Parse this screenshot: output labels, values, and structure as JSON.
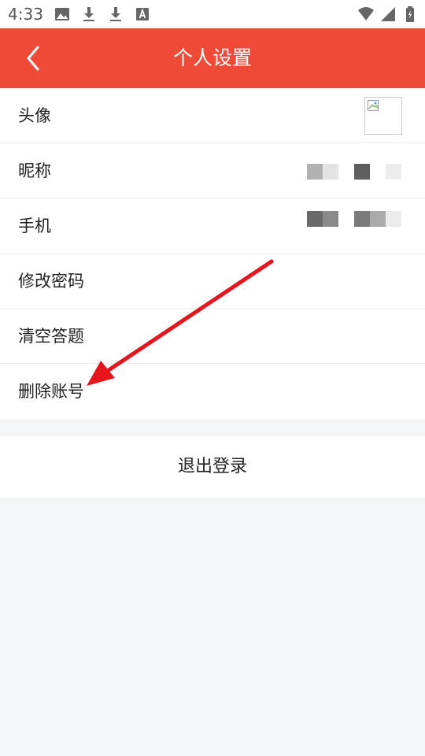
{
  "status_bar": {
    "time": "4:33",
    "left_icons": [
      "image-icon",
      "download-icon",
      "download-icon",
      "font-icon"
    ],
    "right_icons": [
      "wifi-icon",
      "signal-icon",
      "battery-icon"
    ]
  },
  "header": {
    "title": "个人设置",
    "back_icon": "chevron-left-icon",
    "background_color": "#ef4a37"
  },
  "settings": {
    "items": [
      {
        "label": "头像"
      },
      {
        "label": "昵称"
      },
      {
        "label": "手机"
      },
      {
        "label": "修改密码"
      },
      {
        "label": "清空答题"
      },
      {
        "label": "删除账号"
      }
    ]
  },
  "logout": {
    "label": "退出登录"
  },
  "annotation": {
    "arrow_color": "#e8141b",
    "points_to": "删除账号"
  }
}
